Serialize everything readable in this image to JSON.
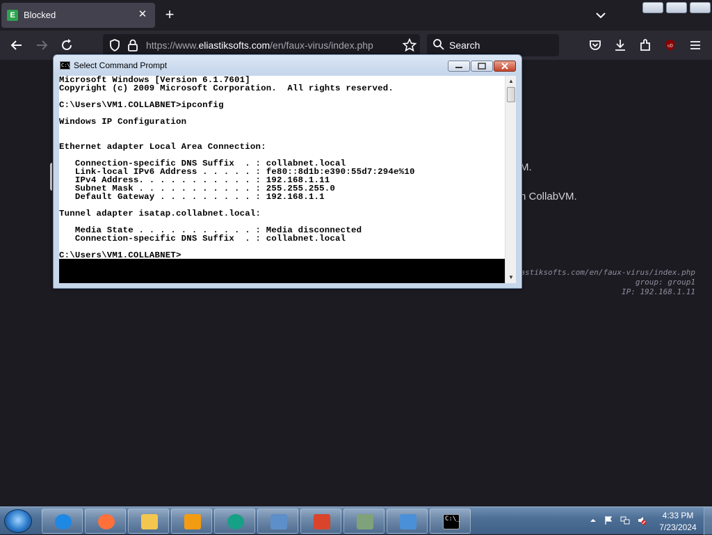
{
  "browser": {
    "tab_title": "Blocked",
    "tab_favicon_letter": "E",
    "url_prefix": "https://www.",
    "url_domain": "eliastiksofts.com",
    "url_path": "/en/faux-virus/index.php",
    "search_placeholder": "Search",
    "accent": "#2ea44f"
  },
  "page": {
    "line1_partial": "M.",
    "line2_partial": "n CollabVM.",
    "meta_url": "eliastiksofts.com/en/faux-virus/index.php",
    "meta_group": "group: group1",
    "meta_ip": "IP: 192.168.1.11"
  },
  "cmd": {
    "title": "Select Command Prompt",
    "icon_text": "C:\\_",
    "output": "Microsoft Windows [Version 6.1.7601]\nCopyright (c) 2009 Microsoft Corporation.  All rights reserved.\n\nC:\\Users\\VM1.COLLABNET>ipconfig\n\nWindows IP Configuration\n\n\nEthernet adapter Local Area Connection:\n\n   Connection-specific DNS Suffix  . : collabnet.local\n   Link-local IPv6 Address . . . . . : fe80::8d1b:e390:55d7:294e%10\n   IPv4 Address. . . . . . . . . . . : 192.168.1.11\n   Subnet Mask . . . . . . . . . . . : 255.255.255.0\n   Default Gateway . . . . . . . . . : 192.168.1.1\n\nTunnel adapter isatap.collabnet.local:\n\n   Media State . . . . . . . . . . . : Media disconnected\n   Connection-specific DNS Suffix  . : collabnet.local\n\nC:\\Users\\VM1.COLLABNET>"
  },
  "taskbar": {
    "time": "4:33 PM",
    "date": "7/23/2024",
    "apps": [
      {
        "name": "Internet Explorer",
        "icon": "ie-icon",
        "color": "#1e88e5"
      },
      {
        "name": "Firefox",
        "icon": "firefox-icon",
        "color": "#ff7139"
      },
      {
        "name": "Windows Explorer",
        "icon": "folder-icon",
        "color": "#f3c74f"
      },
      {
        "name": "Media Player",
        "icon": "media-player-icon",
        "color": "#f39c12"
      },
      {
        "name": "App",
        "icon": "play-circle-icon",
        "color": "#16a085"
      },
      {
        "name": "Remote Desktop",
        "icon": "computer-icon",
        "color": "#5d8fc9"
      },
      {
        "name": "App",
        "icon": "red-app-icon",
        "color": "#d9442a"
      },
      {
        "name": "App",
        "icon": "network-icon",
        "color": "#7fa27a"
      },
      {
        "name": "App",
        "icon": "window-icon",
        "color": "#4a90d9"
      },
      {
        "name": "Command Prompt",
        "icon": "cmd-icon",
        "color": "#000000"
      }
    ]
  }
}
